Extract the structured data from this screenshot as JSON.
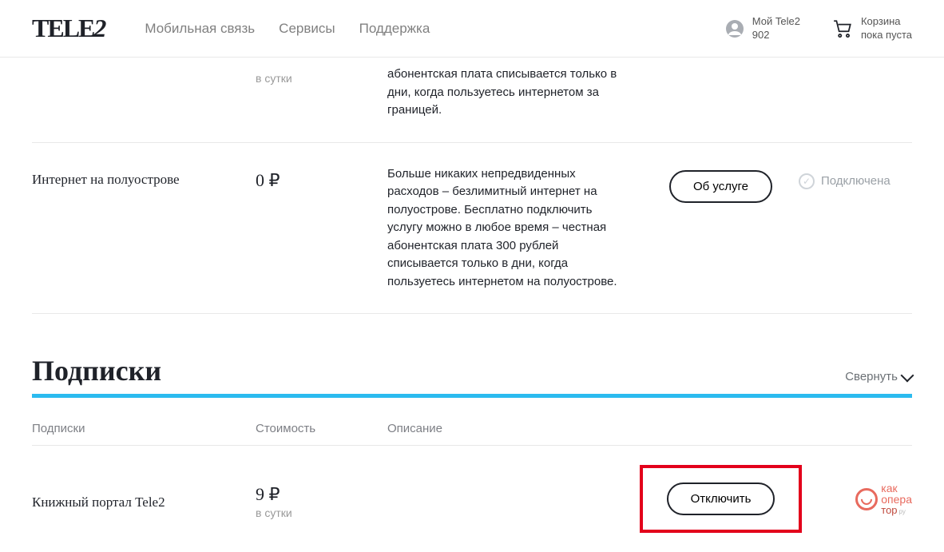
{
  "header": {
    "logo": "TELE2",
    "nav": [
      "Мобильная связь",
      "Сервисы",
      "Поддержка"
    ],
    "account": {
      "line1": "Мой Tele2",
      "line2": "902"
    },
    "cart": {
      "line1": "Корзина",
      "line2": "пока пуста"
    }
  },
  "services": [
    {
      "name": "",
      "price": "",
      "per_day": "в сутки",
      "description": "абонентская плата списывается только в дни, когда пользуетесь интернетом за границей.",
      "action": "",
      "status": ""
    },
    {
      "name": "Интернет на полуострове",
      "price": "0 ₽",
      "per_day": "",
      "description": "Больше никаких непредвиденных расходов – безлимитный интернет на полуострове. Бесплатно подключить услугу можно в любое время – честная абонентская плата 300 рублей списывается только в дни, когда пользуетесь интернетом на полуострове.",
      "action": "Об услуге",
      "status": "Подключена"
    }
  ],
  "subs_section": {
    "title": "Подписки",
    "collapse": "Свернуть",
    "columns": {
      "name": "Подписки",
      "price": "Стоимость",
      "desc": "Описание"
    },
    "rows": [
      {
        "name": "Книжный портал Tele2",
        "price": "9 ₽",
        "per_day": "в сутки",
        "action": "Отключить"
      }
    ]
  },
  "watermark": {
    "t1": "как",
    "t2": "опера",
    "t3": "тор",
    "sub": "ру"
  }
}
